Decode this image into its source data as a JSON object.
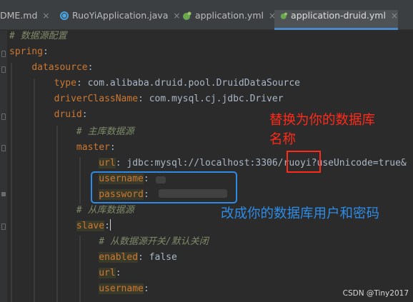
{
  "tabs": [
    {
      "label": "DME.md",
      "close": "×"
    },
    {
      "label": "RuoYiApplication.java",
      "close": "×"
    },
    {
      "label": "application.yml",
      "close": "×"
    },
    {
      "label": "application-druid.yml",
      "close": "×",
      "active": true
    }
  ],
  "code": {
    "l1": "# 数据源配置",
    "l2_key": "spring",
    "l3_key": "datasource",
    "l4_key": "type",
    "l4_val": "com.alibaba.druid.pool.DruidDataSource",
    "l5_key": "driverClassName",
    "l5_val": "com.mysql.cj.jdbc.Driver",
    "l6_key": "druid",
    "l7": "# 主库数据源",
    "l8_key": "master",
    "l9_key": "url",
    "l9_val_pre": "jdbc:mysql://localhost:3306/",
    "l9_val_db": "ruoyi",
    "l9_val_post": "?useUnicode=true&",
    "l10_key": "username",
    "l11_key": "password",
    "l12": "# 从库数据源",
    "l13_key": "slave",
    "l14": "# 从数据源开关/默认关闭",
    "l15_key": "enabled",
    "l15_val": "false",
    "l16_key": "url",
    "l17_key": "username",
    "colon": ":"
  },
  "annotations": {
    "red_note": "替换为你的数据库名称",
    "blue_note": "改成你的数据库用户和密码"
  },
  "watermark": "CSDN @Tiny2017",
  "colors": {
    "annotation_red": "#ff2a1a",
    "annotation_blue": "#2e8ce6",
    "yaml_key": "#cc7832",
    "comment": "#7f8b69"
  }
}
